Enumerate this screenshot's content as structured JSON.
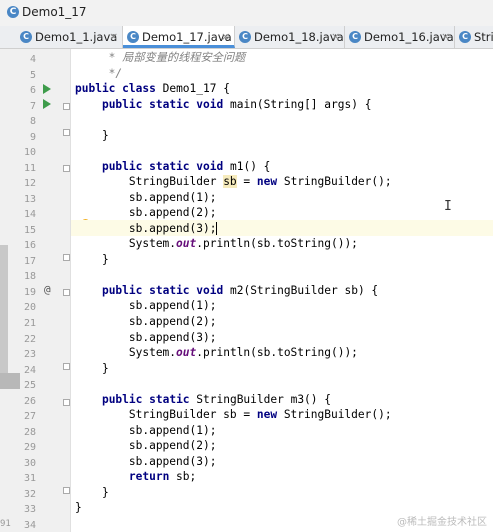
{
  "window": {
    "title": "Demo1_17"
  },
  "tabs": [
    {
      "label": "Demo1_1.java",
      "active": false
    },
    {
      "label": "Demo1_17.java",
      "active": true
    },
    {
      "label": "Demo1_18.java",
      "active": false
    },
    {
      "label": "Demo1_16.java",
      "active": false
    },
    {
      "label": "Strin",
      "active": false
    }
  ],
  "editor": {
    "line_numbers": [
      "4",
      "5",
      "6",
      "7",
      "8",
      "9",
      "10",
      "11",
      "12",
      "13",
      "14",
      "15",
      "16",
      "17",
      "18",
      "19",
      "20",
      "21",
      "22",
      "23",
      "24",
      "25",
      "26",
      "27",
      "28",
      "29",
      "30",
      "31",
      "32",
      "33",
      "34"
    ],
    "lines": [
      "     * 局部变量的线程安全问题",
      "     */",
      "public class Demo1_17 {",
      "    public static void main(String[] args) {",
      "",
      "    }",
      "",
      "    public static void m1() {",
      "        StringBuilder sb = new StringBuilder();",
      "        sb.append(1);",
      "        sb.append(2);",
      "        sb.append(3);",
      "        System.out.println(sb.toString());",
      "    }",
      "",
      "    public static void m2(StringBuilder sb) {",
      "        sb.append(1);",
      "        sb.append(2);",
      "        sb.append(3);",
      "        System.out.println(sb.toString());",
      "    }",
      "",
      "    public static StringBuilder m3() {",
      "        StringBuilder sb = new StringBuilder();",
      "        sb.append(1);",
      "        sb.append(2);",
      "        sb.append(3);",
      "        return sb;",
      "    }",
      "}",
      ""
    ],
    "current_line": "15",
    "bottom_cutoff_number": "91"
  },
  "watermark": "@稀土掘金技术社区",
  "icons": {
    "file": "java-class-icon",
    "run": "run-gutter-icon",
    "override": "at-override-icon",
    "intention": "lightbulb-icon",
    "close": "close-icon"
  }
}
